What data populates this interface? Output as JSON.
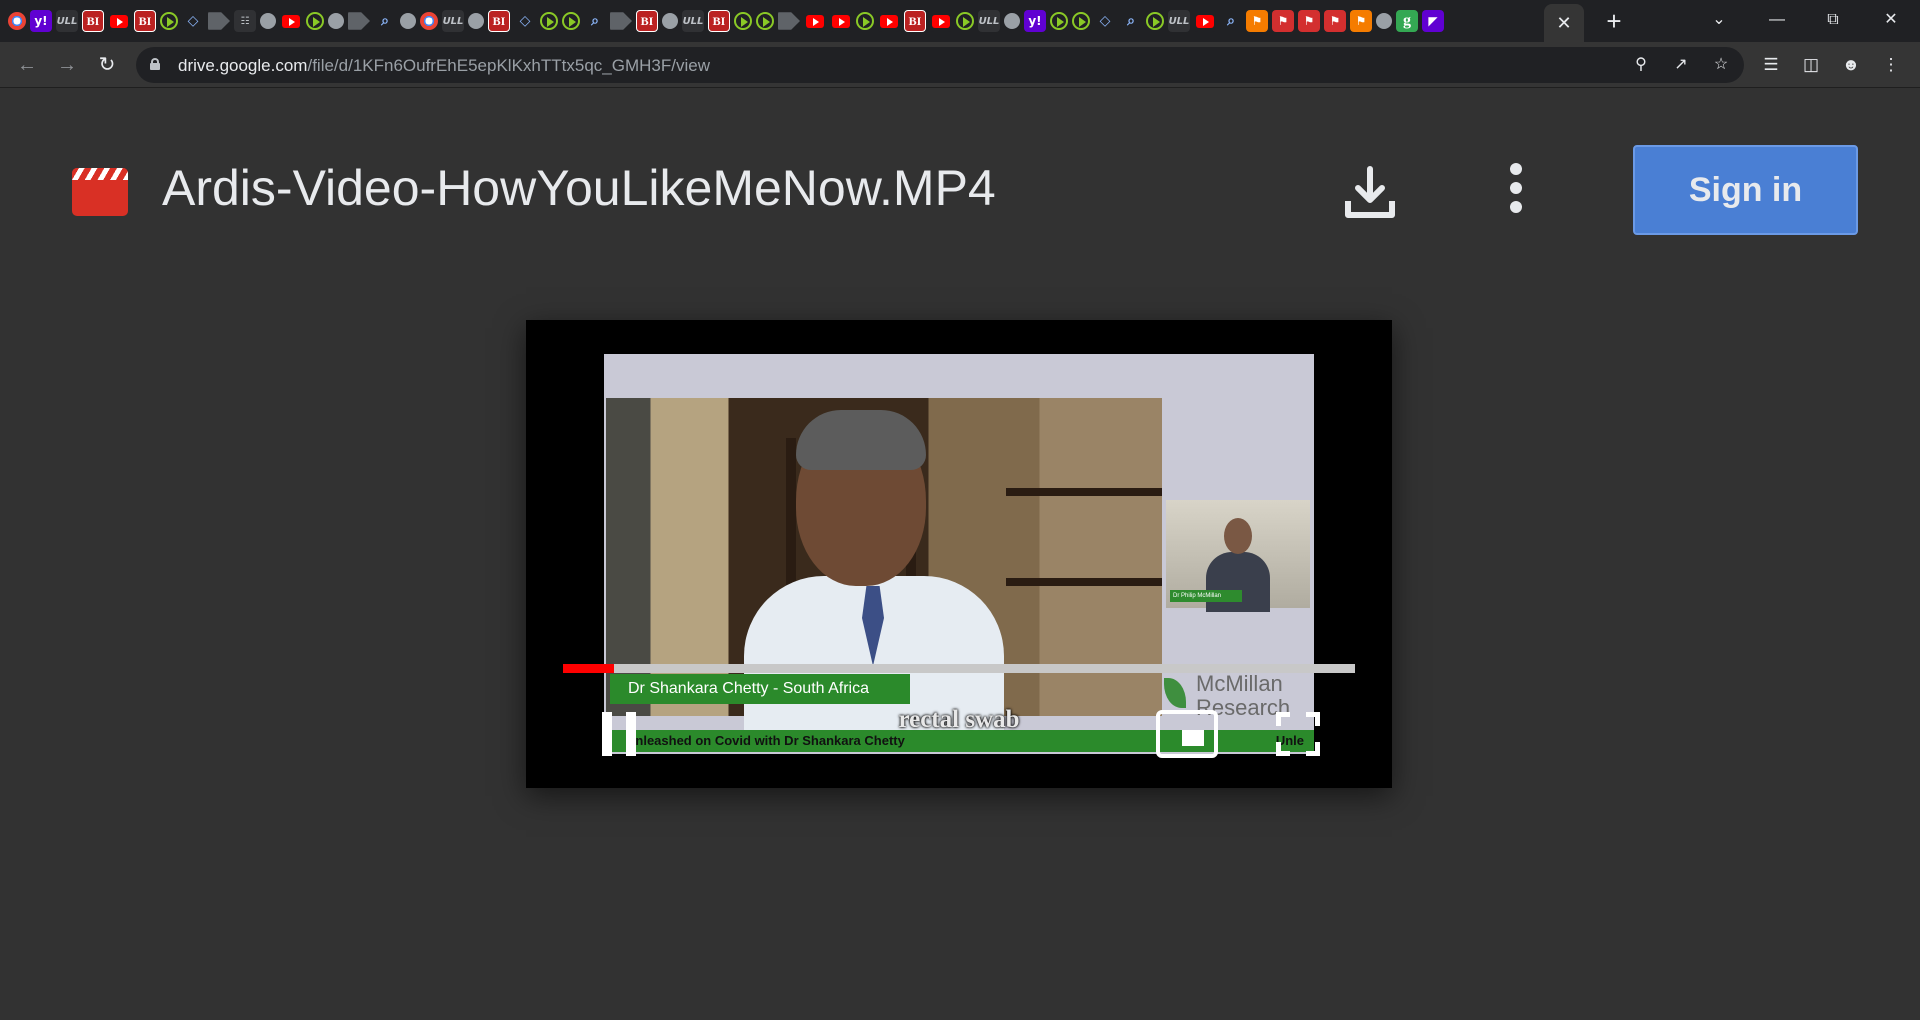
{
  "browser": {
    "tab_icons": [
      "chrome-icon",
      "yahoo-icon",
      "dark-tab-icon",
      "bi-icon",
      "youtube-icon",
      "bi-icon",
      "play-icon",
      "shield-icon",
      "arrow-icon",
      "grid-icon",
      "globe-icon",
      "youtube-icon",
      "play-icon",
      "globe-icon",
      "arrow-icon",
      "search-icon",
      "globe-icon",
      "google-icon",
      "dark-tab-icon",
      "globe-icon",
      "bi-icon",
      "shield-icon",
      "play-icon",
      "play-icon",
      "search-icon",
      "arrow-icon",
      "bi-icon",
      "globe-icon",
      "dark-tab-icon",
      "bi-icon",
      "play-icon",
      "play-icon",
      "arrow-icon",
      "youtube-icon",
      "youtube-icon",
      "play-icon",
      "youtube-icon",
      "bi-icon",
      "youtube-icon",
      "play-icon",
      "dark-tab-icon",
      "globe-icon",
      "yahoo-icon",
      "play-icon",
      "play-icon",
      "shield-icon",
      "search-icon",
      "play-icon",
      "dark-tab-icon",
      "youtube-icon",
      "search-icon",
      "bookmark-icon",
      "red-icon",
      "red-icon",
      "red-icon",
      "bookmark-icon",
      "globe-icon",
      "green-g-icon",
      "purple-icon"
    ],
    "active_tab_close": "✕",
    "new_tab": "+",
    "url_host": "drive.google.com",
    "url_path": "/file/d/1KFn6OufrEhE5epKlKxhTTtx5qc_GMH3F/view"
  },
  "header": {
    "file_title": "Ardis-Video-HowYouLikeMeNow.MP4",
    "signin_label": "Sign in"
  },
  "video": {
    "progress_fraction": 0.065,
    "lower_third": "Dr Shankara Chetty - South Africa",
    "pip_label": "Dr Philip McMillan",
    "caption": "rectal swab",
    "ticker": "Unleashed on Covid with Dr Shankara Chetty",
    "ticker_end": "Unle",
    "brand_line1": "McMillan",
    "brand_line2": "Research"
  },
  "colors": {
    "page_bg": "#323232",
    "signin_bg": "#4a7fd4",
    "progress": "#ff0000",
    "file_icon": "#d93025"
  }
}
